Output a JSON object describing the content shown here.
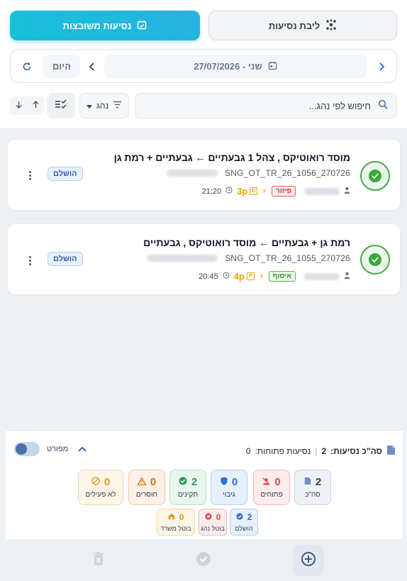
{
  "tabs": {
    "grouped_label": "נסיעות משובצות",
    "pool_label": "ליבת נסיעות"
  },
  "datebar": {
    "date_label": "שני - 27/07/2026",
    "today_label": "היום"
  },
  "search": {
    "placeholder": "חיפוש לפי נהג..."
  },
  "filter": {
    "label": "נהג"
  },
  "trips": [
    {
      "route": "מוסד רואוטיקס , צהל 1 גבעתיים ← גבעתיים + רמת גן",
      "code": "SNG_OT_TR_26_1056_270726",
      "tag": "פיזור",
      "vehicle_letter": "D",
      "vehicle": "3p",
      "time": "21:20",
      "status": "הושלם"
    },
    {
      "route": "רמת גן + גבעתיים ← מוסד רואוטיקס , גבעתיים",
      "code": "SNG_OT_TR_26_1055_270726",
      "tag": "איסוף",
      "vehicle_letter": "P",
      "vehicle": "4p",
      "time": "20:45",
      "status": "הושלם"
    }
  ],
  "summary": {
    "total_label": "סה\"כ נסיעות:",
    "total_value": "2",
    "open_label": "נסיעות פתוחות:",
    "open_value": "0",
    "detailed_label": "מפורט"
  },
  "stats": [
    {
      "label": "סה\"כ",
      "value": "2",
      "color": "#374151"
    },
    {
      "label": "פתוחים",
      "value": "0",
      "color": "#e04848"
    },
    {
      "label": "גיבוי",
      "value": "0",
      "color": "#2f6fd6"
    },
    {
      "label": "תקינים",
      "value": "2",
      "color": "#2f9b57"
    },
    {
      "label": "חוסרים",
      "value": "0",
      "color": "#e06a1b"
    },
    {
      "label": "לא פעילים",
      "value": "0",
      "color": "#e0961b"
    }
  ],
  "sub_stats": [
    {
      "label": "הושלם",
      "value": "2",
      "color": "#2f6fd6"
    },
    {
      "label": "בוטל נהג",
      "value": "0",
      "color": "#e04848"
    },
    {
      "label": "בוטל משרד",
      "value": "0",
      "color": "#e0961b"
    }
  ]
}
